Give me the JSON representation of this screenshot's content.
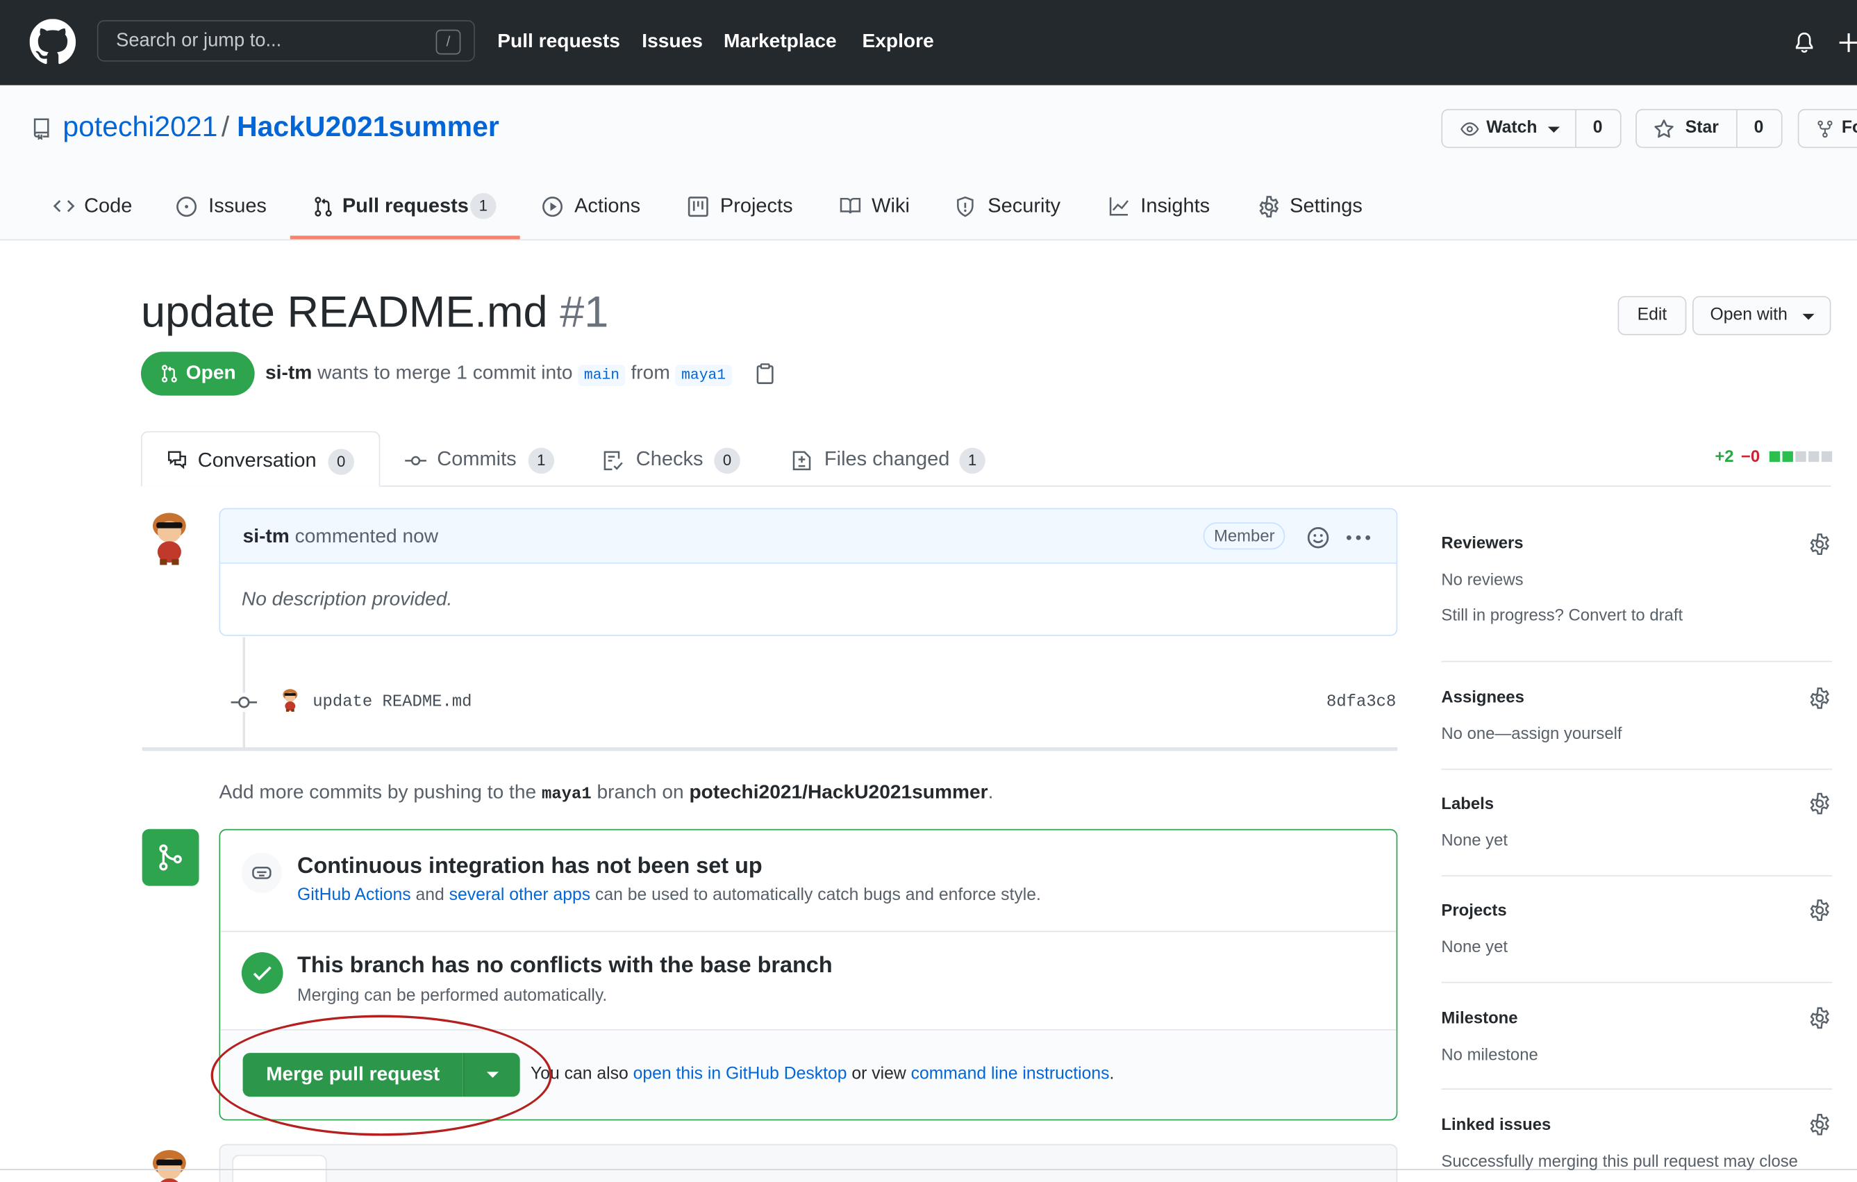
{
  "header": {
    "search_placeholder": "Search or jump to...",
    "search_shortcut": "/",
    "nav": [
      "Pull requests",
      "Issues",
      "Marketplace",
      "Explore"
    ]
  },
  "repo": {
    "owner": "potechi2021",
    "separator": "/",
    "name": "HackU2021summer",
    "watch_label": "Watch",
    "watch_count": "0",
    "star_label": "Star",
    "star_count": "0",
    "fork_label": "Fo"
  },
  "tabs": {
    "code": "Code",
    "issues": "Issues",
    "pull_requests": "Pull requests",
    "pull_requests_count": "1",
    "actions": "Actions",
    "projects": "Projects",
    "wiki": "Wiki",
    "security": "Security",
    "insights": "Insights",
    "settings": "Settings"
  },
  "pr": {
    "title": "update README.md",
    "number": "#1",
    "edit_label": "Edit",
    "open_with_label": "Open with",
    "state": "Open",
    "author": "si-tm",
    "merge_text": "wants to merge 1 commit into",
    "base_branch": "main",
    "from_text": "from",
    "head_branch": "maya1"
  },
  "pr_tabs": {
    "conversation": "Conversation",
    "conversation_count": "0",
    "commits": "Commits",
    "commits_count": "1",
    "checks": "Checks",
    "checks_count": "0",
    "files": "Files changed",
    "files_count": "1",
    "additions": "+2",
    "deletions": "−0"
  },
  "comment": {
    "author": "si-tm",
    "action": "commented now",
    "badge": "Member",
    "body": "No description provided."
  },
  "commit": {
    "message": "update README.md",
    "sha": "8dfa3c8"
  },
  "push_hint": {
    "prefix": "Add more commits by pushing to the",
    "branch": "maya1",
    "middle": "branch on",
    "repo": "potechi2021/HackU2021summer",
    "suffix": "."
  },
  "ci": {
    "title": "Continuous integration has not been set up",
    "link1": "GitHub Actions",
    "and": "and",
    "link2": "several other apps",
    "rest": "can be used to automatically catch bugs and enforce style."
  },
  "conflicts": {
    "title": "This branch has no conflicts with the base branch",
    "subtitle": "Merging can be performed automatically."
  },
  "merge": {
    "button_label": "Merge pull request",
    "also_text": "You can also",
    "desktop_link": "open this in GitHub Desktop",
    "or_view": "or view",
    "cli_link": "command line instructions",
    "period": "."
  },
  "sidebar": {
    "reviewers": {
      "title": "Reviewers",
      "line1": "No reviews",
      "line2": "Still in progress? Convert to draft"
    },
    "assignees": {
      "title": "Assignees",
      "line1": "No one—assign yourself"
    },
    "labels": {
      "title": "Labels",
      "line1": "None yet"
    },
    "projects": {
      "title": "Projects",
      "line1": "None yet"
    },
    "milestone": {
      "title": "Milestone",
      "line1": "No milestone"
    },
    "linked_issues": {
      "title": "Linked issues",
      "line1": "Successfully merging this pull request may close"
    }
  },
  "colors": {
    "header_bg": "#24292e",
    "link": "#0366d6",
    "success": "#2ea44f",
    "tab_underline": "#f9826c",
    "annotation_circle": "#b5201e"
  }
}
